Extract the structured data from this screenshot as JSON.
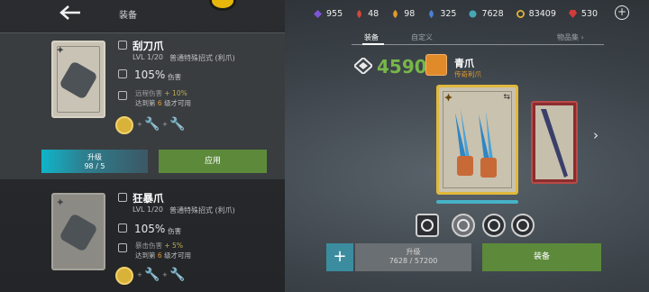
{
  "header": {
    "title": "装备",
    "currencies": [
      {
        "icon": "purple-gem-icon",
        "color": "#7d55d6",
        "value": "955"
      },
      {
        "icon": "red-flame-icon",
        "color": "#d3473a",
        "value": "48"
      },
      {
        "icon": "orange-flame-icon",
        "color": "#e39a2a",
        "value": "98"
      },
      {
        "icon": "blue-flame-icon",
        "color": "#4a7fd4",
        "value": "325"
      },
      {
        "icon": "teal-coin-icon",
        "color": "#46a7b5",
        "value": "7628"
      },
      {
        "icon": "gold-coin-icon",
        "color": "#e1b236",
        "value": "83409"
      },
      {
        "icon": "ruby-icon",
        "color": "#d33b3b",
        "value": "530"
      }
    ]
  },
  "items": [
    {
      "name": "刮刀爪",
      "level": "LVL  1/20",
      "desc": "普通特殊招式 (利爪)",
      "stat_value": "105%",
      "stat_label": "伤害",
      "bonus_label": "远程伤害",
      "bonus_pct": "+ 10%",
      "unlock_prefix": "达到第",
      "unlock_level": "6",
      "unlock_suffix": "级才可用",
      "upgrade_label": "升级",
      "upgrade_progress": "98 / 5",
      "apply_label": "应用"
    },
    {
      "name": "狂暴爪",
      "level": "LVL  1/20",
      "desc": "普通特殊招式 (利爪)",
      "stat_value": "105%",
      "stat_label": "伤害",
      "bonus_label": "暴击伤害",
      "bonus_pct": "+ 5%",
      "unlock_prefix": "达到第",
      "unlock_level": "6",
      "unlock_suffix": "级才可用"
    }
  ],
  "tabs": [
    {
      "label": "装备"
    },
    {
      "label": "自定义"
    },
    {
      "label": "物品集"
    }
  ],
  "detail": {
    "power": "4590",
    "weapon_name": "青爪",
    "weapon_type": "传奇利爪",
    "upgrade_label": "升级",
    "upgrade_cost": "7628 / 57200",
    "equip_label": "装备"
  }
}
